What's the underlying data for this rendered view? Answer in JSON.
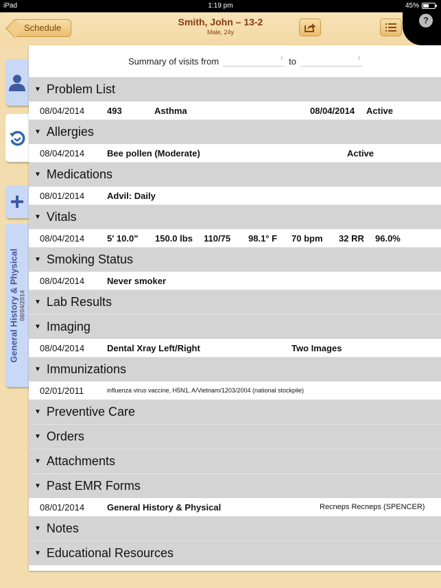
{
  "status_bar": {
    "device": "iPad",
    "time": "1:19 pm",
    "battery": "45%"
  },
  "nav": {
    "back_label": "Schedule",
    "patient_name": "Smith, John – 13-2",
    "patient_sub": "Male, 24y",
    "help_label": "?"
  },
  "sidebar": {
    "form_tab_title": "General History & Physical",
    "form_tab_date": "08/04/2014"
  },
  "filter": {
    "label_from": "Summary of visits from",
    "label_to": "to",
    "from_value": "",
    "to_value": ""
  },
  "sections": {
    "problem_list": {
      "title": "Problem List",
      "rows": [
        {
          "date": "08/04/2014",
          "code": "493",
          "name": "Asthma",
          "date2": "08/04/2014",
          "status": "Active"
        }
      ]
    },
    "allergies": {
      "title": "Allergies",
      "rows": [
        {
          "date": "08/04/2014",
          "name": "Bee pollen (Moderate)",
          "status": "Active"
        }
      ]
    },
    "medications": {
      "title": "Medications",
      "rows": [
        {
          "date": "08/01/2014",
          "name": "Advil: Daily"
        }
      ]
    },
    "vitals": {
      "title": "Vitals",
      "rows": [
        {
          "date": "08/04/2014",
          "height": "5' 10.0\"",
          "weight": "150.0 lbs",
          "bp": "110/75",
          "temp": "98.1° F",
          "pulse": "70 bpm",
          "resp": "32 RR",
          "spo2": "96.0%"
        }
      ]
    },
    "smoking": {
      "title": "Smoking Status",
      "rows": [
        {
          "date": "08/04/2014",
          "name": "Never smoker"
        }
      ]
    },
    "lab": {
      "title": "Lab Results"
    },
    "imaging": {
      "title": "Imaging",
      "rows": [
        {
          "date": "08/04/2014",
          "name": "Dental Xray Left/Right",
          "detail": "Two Images"
        }
      ]
    },
    "immunizations": {
      "title": "Immunizations",
      "rows": [
        {
          "date": "02/01/2011",
          "name": "influenza virus vaccine, H5N1, A/Vietnam/1203/2004 (national stockpile)"
        }
      ]
    },
    "preventive": {
      "title": "Preventive Care"
    },
    "orders": {
      "title": "Orders"
    },
    "attachments": {
      "title": "Attachments"
    },
    "past_forms": {
      "title": "Past EMR Forms",
      "rows": [
        {
          "date": "08/01/2014",
          "name": "General History & Physical",
          "provider": "Recneps Recneps (SPENCER)"
        }
      ]
    },
    "notes": {
      "title": "Notes"
    },
    "education": {
      "title": "Educational Resources"
    }
  }
}
